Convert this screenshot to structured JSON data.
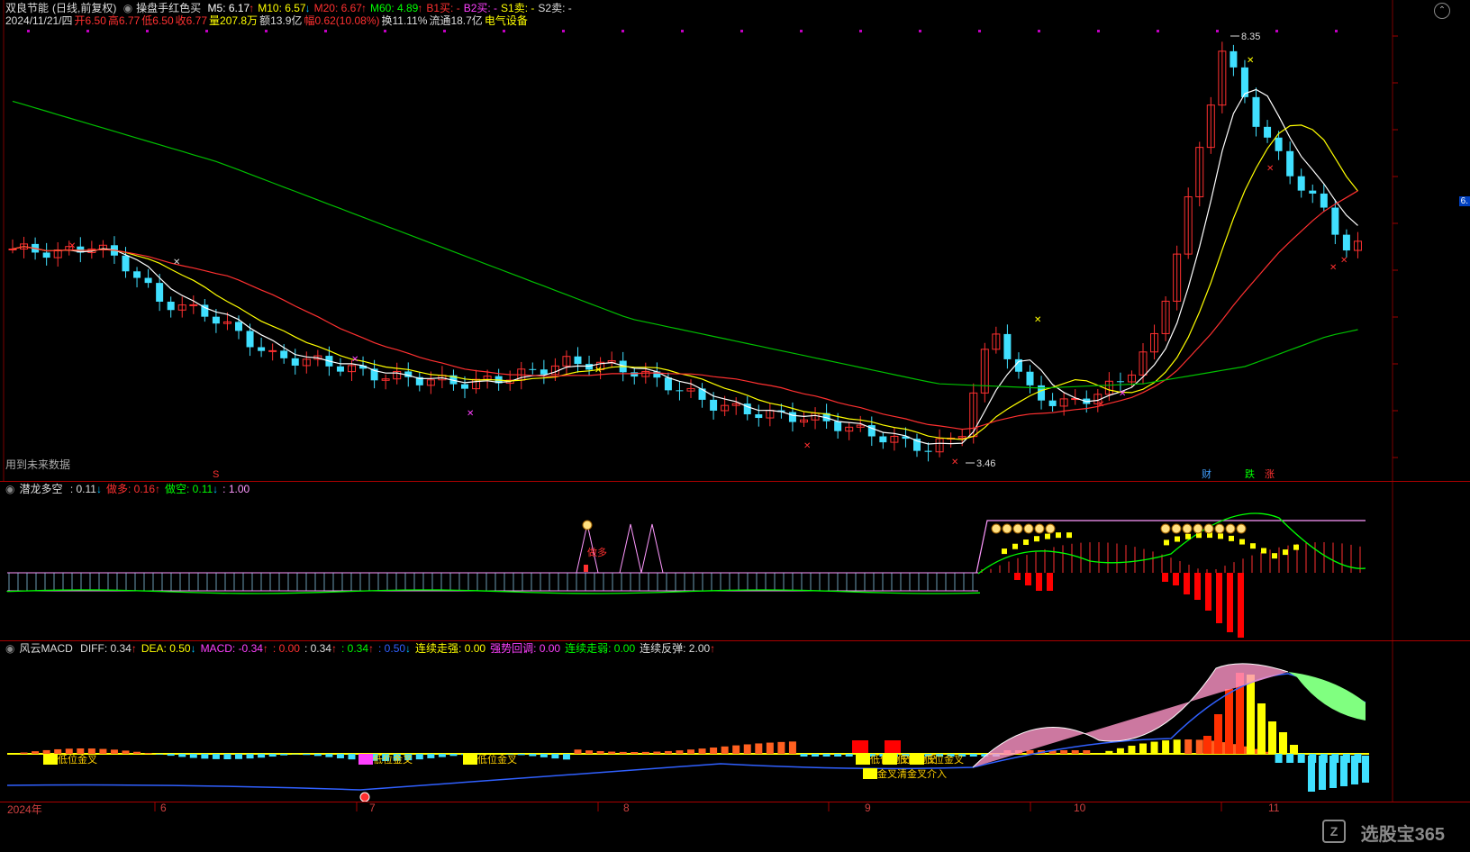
{
  "main": {
    "stock_name": "双良节能",
    "mode": "(日线,前复权)",
    "formula": "操盘手红色买",
    "ma": [
      {
        "label": "M5:",
        "value": "6.17",
        "arrow": "↑",
        "color": "#ffffff"
      },
      {
        "label": "M10:",
        "value": "6.57",
        "arrow": "↓",
        "color": "#ffff00"
      },
      {
        "label": "M20:",
        "value": "6.67",
        "arrow": "↑",
        "color": "#ff3030"
      },
      {
        "label": "M60:",
        "value": "4.89",
        "arrow": "↑",
        "color": "#00ff00"
      },
      {
        "label": "B1买:",
        "value": "-",
        "arrow": "",
        "color": "#ff3030"
      },
      {
        "label": "B2买:",
        "value": "-",
        "arrow": "",
        "color": "#ff40ff"
      },
      {
        "label": "S1卖:",
        "value": "-",
        "arrow": "",
        "color": "#ffff00"
      },
      {
        "label": "S2卖:",
        "value": "-",
        "arrow": "",
        "color": "#dddddd"
      }
    ],
    "info": {
      "date": "2024/11/21/四",
      "open_label": "开",
      "open": "6.50",
      "high_label": "高",
      "high": "6.77",
      "low_label": "低",
      "low": "6.50",
      "close_label": "收",
      "close": "6.77",
      "vol_label": "量",
      "vol": "207.8万",
      "amt_label": "额",
      "amt": "13.9亿",
      "chg_label": "幅",
      "chg": "0.62(10.08%)",
      "turn_label": "换",
      "turn": "11.11%",
      "float_label": "流通",
      "float": "18.7亿",
      "sector": "电气设备"
    },
    "future_note": "用到未来数据",
    "high_mark": "8.35",
    "low_mark": "3.46",
    "tags": [
      "财",
      "跌",
      "涨"
    ],
    "s_mark": "S",
    "right_label": "6."
  },
  "ind1": {
    "name": "潜龙多空",
    "items": [
      {
        "label": ":",
        "value": "0.11",
        "arrow": "↓",
        "color": "#dddddd"
      },
      {
        "label": "做多:",
        "value": "0.16",
        "arrow": "↑",
        "color": "#ff3030"
      },
      {
        "label": "做空:",
        "value": "0.11",
        "arrow": "↓",
        "color": "#00ff00"
      },
      {
        "label": ":",
        "value": "1.00",
        "arrow": "",
        "color": "#ff99ff"
      }
    ],
    "zuoduo": "做多"
  },
  "ind2": {
    "name": "风云MACD",
    "items": [
      {
        "label": "DIFF:",
        "value": "0.34",
        "arrow": "↑",
        "color": "#dddddd"
      },
      {
        "label": "DEA:",
        "value": "0.50",
        "arrow": "↓",
        "color": "#ffff00"
      },
      {
        "label": "MACD:",
        "value": "-0.34",
        "arrow": "↑",
        "color": "#ff40ff"
      },
      {
        "label": ":",
        "value": "0.00",
        "arrow": "",
        "color": "#ff3030"
      },
      {
        "label": ":",
        "value": "0.34",
        "arrow": "↑",
        "color": "#dddddd"
      },
      {
        "label": ":",
        "value": "0.34",
        "arrow": "↑",
        "color": "#00ff00"
      },
      {
        "label": ":",
        "value": "0.50",
        "arrow": "↓",
        "color": "#3060ff"
      },
      {
        "label": "连续走强:",
        "value": "0.00",
        "arrow": "",
        "color": "#ffff00"
      },
      {
        "label": "强势回调:",
        "value": "0.00",
        "arrow": "",
        "color": "#ff40ff"
      },
      {
        "label": "连续走弱:",
        "value": "0.00",
        "arrow": "",
        "color": "#00ff00"
      },
      {
        "label": "连续反弹:",
        "value": "2.00",
        "arrow": "↑",
        "color": "#dddddd"
      }
    ],
    "tags": [
      "低位金叉",
      "低位金叉",
      "低位金叉",
      "低位金叉",
      "低位金叉",
      "低位金叉",
      "金叉清金叉介入"
    ]
  },
  "xaxis": [
    "2024年",
    "6",
    "7",
    "8",
    "9",
    "10",
    "11"
  ],
  "watermark": "选股宝365"
}
